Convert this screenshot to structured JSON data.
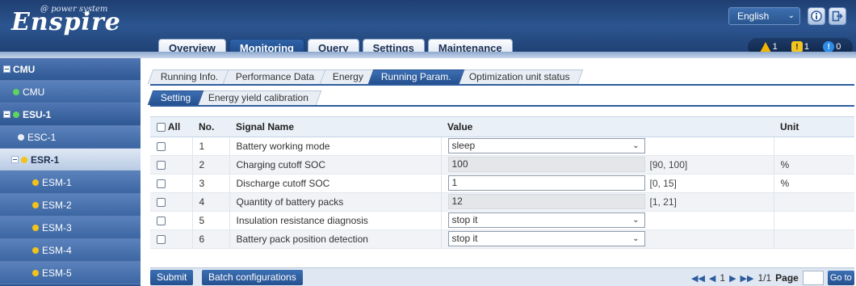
{
  "logo": {
    "sub": "power system",
    "main": "Enspire"
  },
  "header": {
    "language": "English",
    "nav_tabs": [
      "Overview",
      "Monitoring",
      "Query",
      "Settings",
      "Maintenance"
    ],
    "active_nav": "Monitoring",
    "alarms": [
      {
        "type": "major",
        "count": "1",
        "color": "#f2b600"
      },
      {
        "type": "minor",
        "count": "1",
        "color": "#f4c520"
      },
      {
        "type": "info",
        "count": "0",
        "color": "#2d8ce6"
      }
    ]
  },
  "sidebar": {
    "items": [
      {
        "label": "CMU",
        "level": 0,
        "expander": true,
        "dot": null
      },
      {
        "label": "CMU",
        "level": 1,
        "expander": false,
        "dot": "green"
      },
      {
        "label": "ESU-1",
        "level": 0,
        "expander": true,
        "dot": "green"
      },
      {
        "label": "ESC-1",
        "level": 1,
        "expander": false,
        "dot": "white"
      },
      {
        "label": "ESR-1",
        "level": 1,
        "expander": true,
        "dot": "yellow",
        "selected": true
      },
      {
        "label": "ESM-1",
        "level": 2,
        "expander": false,
        "dot": "yellow"
      },
      {
        "label": "ESM-2",
        "level": 2,
        "expander": false,
        "dot": "yellow"
      },
      {
        "label": "ESM-3",
        "level": 2,
        "expander": false,
        "dot": "yellow"
      },
      {
        "label": "ESM-4",
        "level": 2,
        "expander": false,
        "dot": "yellow"
      },
      {
        "label": "ESM-5",
        "level": 2,
        "expander": false,
        "dot": "yellow"
      }
    ]
  },
  "main": {
    "tabs": [
      "Running Info.",
      "Performance Data",
      "Energy",
      "Running Param.",
      "Optimization unit status"
    ],
    "active_tab": "Running Param.",
    "subtabs": [
      "Setting",
      "Energy yield calibration"
    ],
    "active_subtab": "Setting",
    "table": {
      "headers": {
        "all": "All",
        "no": "No.",
        "name": "Signal Name",
        "value": "Value",
        "unit": "Unit"
      },
      "rows": [
        {
          "no": "1",
          "name": "Battery working mode",
          "kind": "select",
          "value": "sleep",
          "range": "",
          "unit": ""
        },
        {
          "no": "2",
          "name": "Charging cutoff SOC",
          "kind": "readonly",
          "value": "100",
          "range": "[90, 100]",
          "unit": "%"
        },
        {
          "no": "3",
          "name": "Discharge cutoff SOC",
          "kind": "input",
          "value": "1",
          "range": "[0, 15]",
          "unit": "%"
        },
        {
          "no": "4",
          "name": "Quantity of battery packs",
          "kind": "readonly",
          "value": "12",
          "range": "[1, 21]",
          "unit": ""
        },
        {
          "no": "5",
          "name": "Insulation resistance diagnosis",
          "kind": "select",
          "value": "stop it",
          "range": "",
          "unit": ""
        },
        {
          "no": "6",
          "name": "Battery pack position detection",
          "kind": "select",
          "value": "stop it",
          "range": "",
          "unit": ""
        }
      ]
    },
    "footer": {
      "submit": "Submit",
      "batch": "Batch configurations",
      "current_page": "1",
      "page_info": "1/1",
      "page_label": "Page",
      "goto": "Go to"
    }
  }
}
